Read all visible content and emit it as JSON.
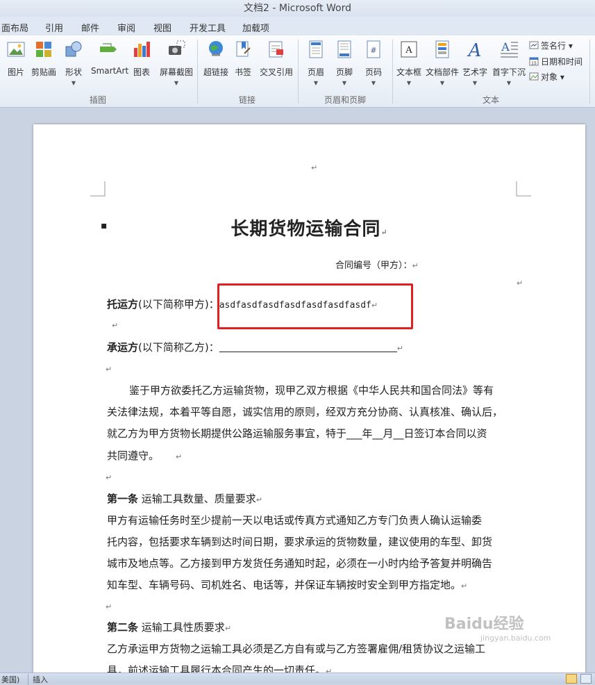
{
  "window": {
    "title": "文档2 - Microsoft Word"
  },
  "tabs": [
    "面布局",
    "引用",
    "邮件",
    "审阅",
    "视图",
    "开发工具",
    "加载项"
  ],
  "ribbon": {
    "groups": {
      "illustrations": "插图",
      "links": "链接",
      "header_footer": "页眉和页脚",
      "text": "文本"
    },
    "buttons": {
      "picture": "图片",
      "clipart": "剪贴画",
      "shapes": "形状",
      "smartart": "SmartArt",
      "chart": "图表",
      "screenshot": "屏幕截图",
      "hyperlink": "超链接",
      "bookmark": "书签",
      "crossref": "交叉引用",
      "header": "页眉",
      "footer": "页脚",
      "pagenum": "页码",
      "textbox": "文本框",
      "quickparts": "文档部件",
      "wordart": "艺术字",
      "dropcap": "首字下沉",
      "signature": "签名行",
      "datetime": "日期和时间",
      "object": "对象"
    }
  },
  "document": {
    "title": "长期货物运输合同",
    "contract_no": "合同编号（甲方）：",
    "shipper_label": "托运方",
    "shipper_suffix": "(以下简称甲方)：",
    "shipper_value": "asdfasdfasdfasdfasdfasdfasdf",
    "carrier_label": "承运方",
    "carrier_suffix": "(以下简称乙方)：",
    "intro": [
      "鉴于甲方欲委托乙方运输货物，现甲乙双方根据《中华人民共和国合同法》等有",
      "关法律法规，本着平等自愿，诚实信用的原则，经双方充分协商、认真核准、确认后，",
      "就乙方为甲方货物长期提供公路运输服务事宜，特于___年__月__日签订本合同以资",
      "共同遵守。"
    ],
    "art1_title": "第一条",
    "art1_heading": "运输工具数量、质量要求",
    "art1_body": [
      "甲方有运输任务时至少提前一天以电话或传真方式通知乙方专门负责人确认运输委",
      "托内容，包括要求车辆到达时间日期，要求承运的货物数量，建议使用的车型、卸货",
      "城市及地点等。乙方接到甲方发货任务通知时起，必须在一小时内给予答复并明确告",
      "知车型、车辆号码、司机姓名、电话等，并保证车辆按时安全到甲方指定地。"
    ],
    "art2_title": "第二条",
    "art2_heading": "运输工具性质要求",
    "art2_body": [
      "乙方承运甲方货物之运输工具必须是乙方自有或与乙方签署雇佣/租赁协议之运输工",
      "具，前述运输工具履行本合同产生的一切责任。"
    ]
  },
  "statusbar": {
    "language": "美国)",
    "mode": "插入"
  },
  "watermark": {
    "text": "Baidu经验",
    "url": "jingyan.baidu.com"
  },
  "colors": {
    "highlight": "#e02020",
    "ribbon_bg": "#eef3f9",
    "doc_bg": "#c9d3e1"
  }
}
